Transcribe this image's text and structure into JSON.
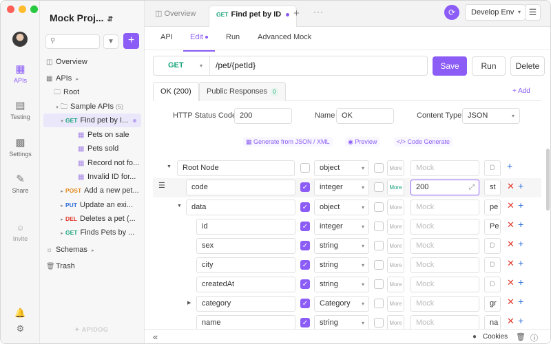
{
  "colors": {
    "accent": "#8b5cf6",
    "get": "#16a37a",
    "post": "#e08a1b",
    "put": "#2f6fd8",
    "delete": "#e0392b"
  },
  "window": {
    "traffic_lights": [
      "#ff5f57",
      "#febc2e",
      "#28c840"
    ]
  },
  "rail": {
    "items": [
      {
        "icon": "apis-icon",
        "label": "APIs"
      },
      {
        "icon": "testing-icon",
        "label": "Testing"
      },
      {
        "icon": "settings-icon",
        "label": "Settings"
      },
      {
        "icon": "share-icon",
        "label": "Share"
      },
      {
        "icon": "invite-icon",
        "label": "Invite"
      }
    ]
  },
  "sidebar": {
    "project_title": "Mock Proj...",
    "overview": "Overview",
    "apis": "APIs",
    "root": "Root",
    "sample_folder": "Sample APIs",
    "sample_count": "(5)",
    "endpoints": [
      {
        "method": "GET",
        "name": "Find pet by I..."
      },
      {
        "method": "POST",
        "name": "Add a new pet..."
      },
      {
        "method": "PUT",
        "name": "Update an exi..."
      },
      {
        "method": "DEL",
        "name": "Deletes a pet (..."
      },
      {
        "method": "GET",
        "name": "Finds Pets by ..."
      }
    ],
    "examples": [
      "Pets on sale",
      "Pets sold",
      "Record not fo...",
      "Invalid ID for..."
    ],
    "schemas": "Schemas",
    "trash": "Trash",
    "footer_logo": "APIDOG"
  },
  "tabs": {
    "overview": "Overview",
    "active_method": "GET",
    "active_label": "Find pet by ID"
  },
  "env": {
    "label": "Develop Env"
  },
  "subtabs": {
    "api": "API",
    "edit": "Edit",
    "run": "Run",
    "advanced_mock": "Advanced Mock"
  },
  "request": {
    "method": "GET",
    "path": "/pet/{petId}",
    "save": "Save",
    "run": "Run",
    "delete": "Delete"
  },
  "response": {
    "tab_ok": "OK (200)",
    "tab_public": "Public Responses",
    "public_count": "0",
    "add": "+ Add",
    "status_label": "HTTP Status Code",
    "status_value": "200",
    "name_label": "Name",
    "name_value": "OK",
    "content_type_label": "Content Type",
    "content_type_value": "JSON",
    "gen_json": "Generate from JSON / XML",
    "preview": "Preview",
    "code_gen": "Code Generate"
  },
  "schema": {
    "more_label": "More",
    "mock_placeholder": "Mock",
    "root_row": {
      "name": "Root Node",
      "type": "object",
      "desc": "D"
    },
    "code_row": {
      "name": "code",
      "type": "integer",
      "mock": "200",
      "desc": "st"
    },
    "data_row": {
      "name": "data",
      "type": "object",
      "desc": "pe"
    },
    "children": [
      {
        "name": "id",
        "type": "integer",
        "desc": "Pe"
      },
      {
        "name": "sex",
        "type": "string",
        "desc": "D"
      },
      {
        "name": "city",
        "type": "string",
        "desc": "D"
      },
      {
        "name": "createdAt",
        "type": "string",
        "desc": "D"
      },
      {
        "name": "category",
        "type": "Category",
        "desc": "gr"
      },
      {
        "name": "name",
        "type": "string",
        "desc": "na"
      }
    ]
  },
  "status": {
    "cookies": "Cookies"
  }
}
